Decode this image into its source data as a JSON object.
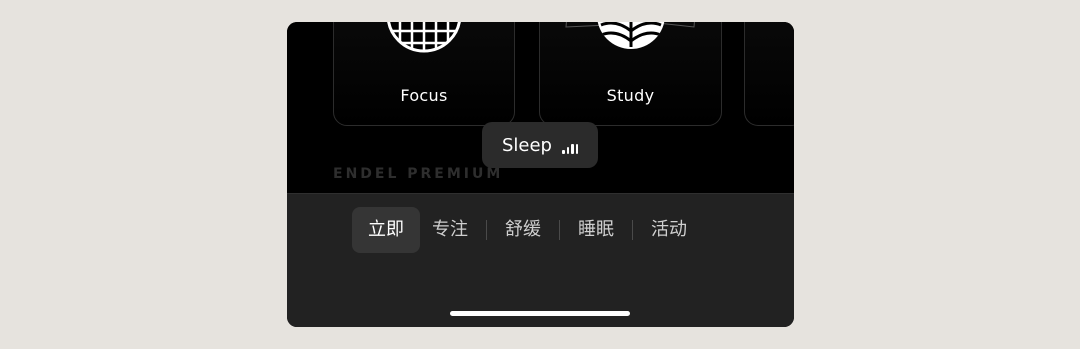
{
  "cards": [
    {
      "label": "Focus",
      "icon": "grid-globe-icon"
    },
    {
      "label": "Study",
      "icon": "open-book-icon"
    }
  ],
  "premium_text": "ENDEL PREMIUM",
  "toast": {
    "label": "Sleep",
    "icon": "audio-bars-icon"
  },
  "tabs": [
    {
      "label": "立即",
      "active": true
    },
    {
      "label": "专注",
      "active": false
    },
    {
      "label": "舒缓",
      "active": false
    },
    {
      "label": "睡眠",
      "active": false
    },
    {
      "label": "活动",
      "active": false
    }
  ]
}
